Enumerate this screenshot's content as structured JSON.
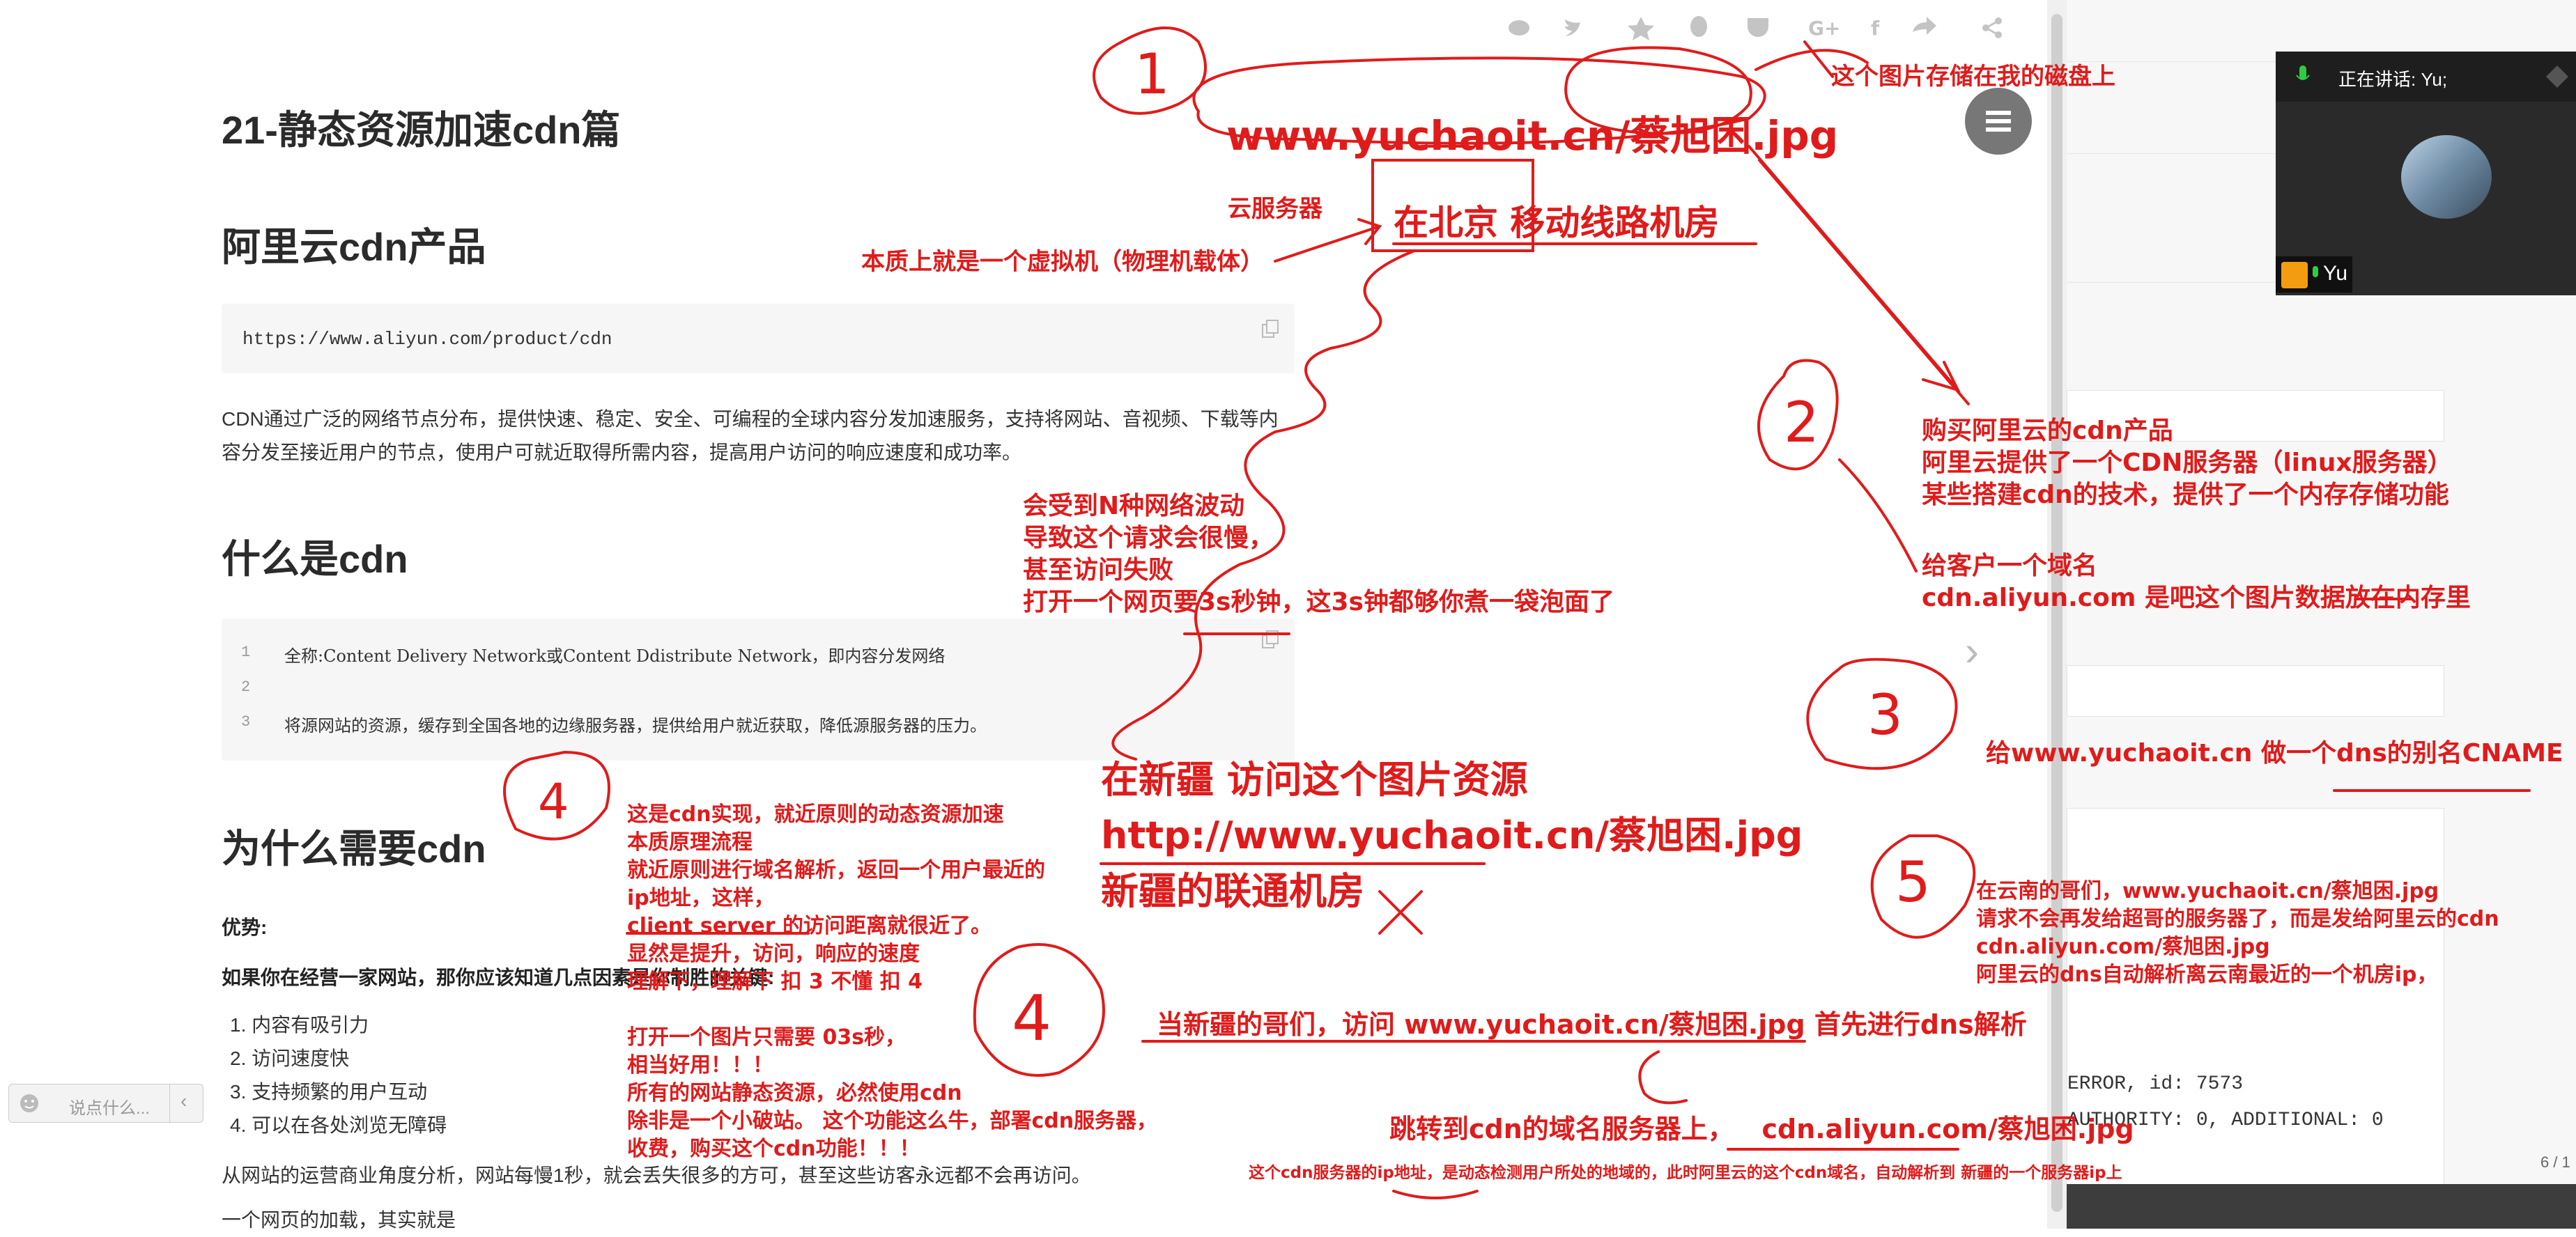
{
  "share_bar": {
    "icons": [
      "weibo-icon",
      "twitter-icon",
      "star-icon",
      "qq-icon",
      "pocket-icon",
      "google-plus-icon",
      "facebook-icon",
      "forward-icon",
      "share-icon"
    ]
  },
  "article": {
    "title": "21-静态资源加速cdn篇",
    "sec1": "阿里云cdn产品",
    "code1": "https://www.aliyun.com/product/cdn",
    "para1_line1": "CDN通过广泛的网络节点分布，提供快速、稳定、安全、可编程的全球内容分发加速服务，支持将网站、音视频、下载等内",
    "para1_line2": "容分发至接近用户的节点，使用户可就近取得所需内容，提高用户访问的响应速度和成功率。",
    "sec2": "什么是cdn",
    "code2": [
      {
        "n": "1",
        "t": "全称:Content Delivery Network或Content Ddistribute Network，即内容分发网络"
      },
      {
        "n": "2",
        "t": ""
      },
      {
        "n": "3",
        "t": "将源网站的资源，缓存到全国各地的边缘服务器，提供给用户就近获取，降低源服务器的压力。"
      }
    ],
    "sec3": "为什么需要cdn",
    "adv": "优势:",
    "intro": "如果你在经营一家网站，那你应该知道几点因素是你制胜的关键:",
    "list": [
      "内容有吸引力",
      "访问速度快",
      "支持频繁的用户互动",
      "可以在各处浏览无障碍"
    ],
    "para3": "从网站的运营商业角度分析，网站每慢1秒，就会丢失很多的方可，甚至这些访客永远都不会再访问。",
    "para4": "一个网页的加载，其实就是"
  },
  "comment_box": {
    "placeholder": "说点什么..."
  },
  "right_panel": {
    "speaking": "正在讲话: Yu;",
    "participant": "Yu",
    "log1": "ERROR, id: 7573",
    "log2": "AUTHORITY: 0, ADDITIONAL: 0",
    "page": "6 / 1"
  },
  "annotations": {
    "circle1": "1",
    "url_top": "www.yuchaoit.cn/蔡旭困.jpg",
    "disk_note": "这个图片存储在我的磁盘上",
    "cloud_server": "云服务器",
    "beijing": "在北京 移动线路机房",
    "vm_note": "本质上就是一个虚拟机（物理机载体）",
    "circle2": "2",
    "buy_1": "购买阿里云的cdn产品",
    "buy_2": "阿里云提供了一个CDN服务器（linux服务器）",
    "buy_3": "某些搭建cdn的技术，提供了一个内存存储功能",
    "domain_1": "给客户一个域名",
    "domain_2": "cdn.aliyun.com  是吧这个图片数据放在内存里",
    "net_1": "会受到N种网络波动",
    "net_2": "导致这个请求会很慢，",
    "net_3": "甚至访问失败",
    "net_4": "打开一个网页要3s秒钟，这3s钟都够你煮一袋泡面了",
    "circle3": "3",
    "cname": "给www.yuchaoit.cn 做一个dns的别名CNAME",
    "xj_1": "在新疆 访问这个图片资源",
    "xj_2": "http://www.yuchaoit.cn/蔡旭困.jpg",
    "xj_3": "新疆的联通机房",
    "dyn_1": "这是cdn实现，就近原则的动态资源加速",
    "dyn_2": "本质原理流程",
    "dyn_3": "就近原则进行域名解析，返回一个用户最近的",
    "dyn_4": "ip地址，这样，",
    "dyn_5": "client  server 的访问距离就很近了。",
    "dyn_6": "显然是提升，访问，响应的速度",
    "dyn_7": "理解下，理解下 扣 3  不懂 扣 4",
    "dyn_8": "打开一个图片只需要 03s秒，",
    "dyn_9": "相当好用！！！",
    "dyn_10": "所有的网站静态资源，必然使用cdn",
    "dyn_11": "除非是一个小破站。     这个功能这么牛，部署cdn服务器，",
    "dyn_12": "收费，购买这个cdn功能！！！",
    "circle4": "4",
    "circle5": "5",
    "yn_1": "在云南的哥们，www.yuchaoit.cn/蔡旭困.jpg",
    "yn_2": "请求不会再发给超哥的服务器了，而是发给阿里云的cdn",
    "yn_3": "cdn.aliyun.com/蔡旭困.jpg",
    "yn_4": "阿里云的dns自动解析离云南最近的一个机房ip，",
    "xj_dns": "当新疆的哥们，访问 www.yuchaoit.cn/蔡旭困.jpg 首先进行dns解析",
    "jump": "跳转到cdn的域名服务器上，   cdn.aliyun.com/蔡旭困.jpg",
    "bottom": "这个cdn服务器的ip地址，是动态检测用户所处的地域的，此时阿里云的这个cdn域名，自动解析到 新疆的一个服务器ip上"
  }
}
